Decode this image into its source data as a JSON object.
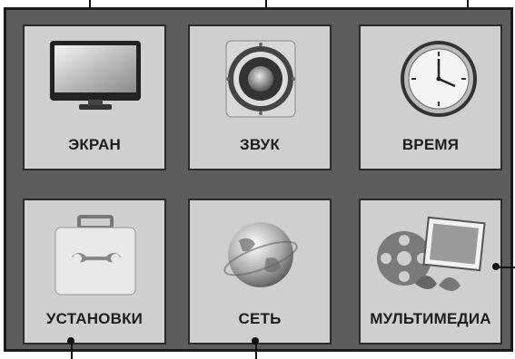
{
  "menu": {
    "tiles": [
      {
        "label": "ЭКРАН",
        "icon": "tv-monitor-icon"
      },
      {
        "label": "ЗВУК",
        "icon": "speaker-icon"
      },
      {
        "label": "ВРЕМЯ",
        "icon": "clock-icon"
      },
      {
        "label": "УСТАНОВКИ",
        "icon": "toolbox-icon"
      },
      {
        "label": "СЕТЬ",
        "icon": "globe-icon"
      },
      {
        "label": "МУЛЬТИМЕДИА",
        "icon": "multimedia-icon"
      }
    ]
  },
  "colors": {
    "frame": "#5d5d5d",
    "tile": "#cfcfcf",
    "border": "#1a1a1a"
  }
}
